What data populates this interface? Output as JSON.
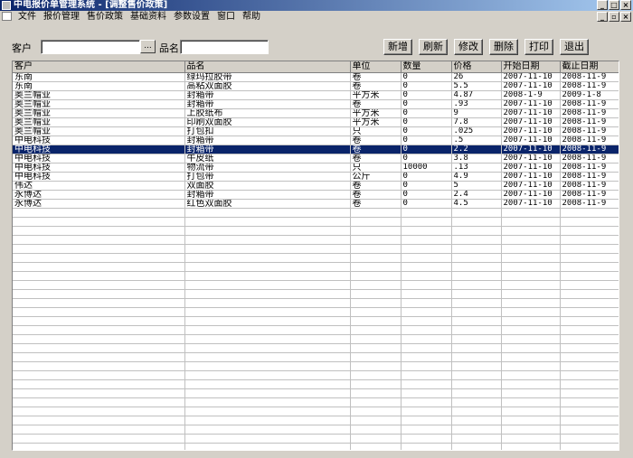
{
  "window": {
    "title": "中电报价单管理系统 - [调整售价政策]"
  },
  "menu": [
    "文件",
    "报价管理",
    "售价政策",
    "基础资料",
    "参数设置",
    "窗口",
    "帮助"
  ],
  "filters": {
    "customer_label": "客户",
    "customer_value": "",
    "ellipsis": "...",
    "product_label": "品名",
    "product_value": ""
  },
  "buttons": {
    "add": "新增",
    "refresh": "刷新",
    "edit": "修改",
    "delete": "删除",
    "print": "打印",
    "exit": "退出"
  },
  "table": {
    "columns": [
      "客户",
      "品名",
      "单位",
      "数量",
      "价格",
      "开始日期",
      "截止日期"
    ],
    "selected_index": 8,
    "rows": [
      [
        "东南",
        "绿玛拉胶带",
        "卷",
        "0",
        "26",
        "2007-11-10",
        "2008-11-9"
      ],
      [
        "东南",
        "高粘双面胶",
        "卷",
        "0",
        "5.5",
        "2007-11-10",
        "2008-11-9"
      ],
      [
        "奥兰帽业",
        "封箱带",
        "平方米",
        "0",
        "4.87",
        "2008-1-9",
        "2009-1-8"
      ],
      [
        "奥兰帽业",
        "封箱带",
        "卷",
        "0",
        ".93",
        "2007-11-10",
        "2008-11-9"
      ],
      [
        "奥兰帽业",
        "上胶纸布",
        "平方米",
        "0",
        "9",
        "2007-11-10",
        "2008-11-9"
      ],
      [
        "奥兰帽业",
        "印刷双面胶",
        "平方米",
        "0",
        "7.8",
        "2007-11-10",
        "2008-11-9"
      ],
      [
        "奥兰帽业",
        "打包扣",
        "只",
        "0",
        ".025",
        "2007-11-10",
        "2008-11-9"
      ],
      [
        "中电科技",
        "封箱带",
        "卷",
        "0",
        ".5",
        "2007-11-10",
        "2008-11-9"
      ],
      [
        "中电科技",
        "封箱带",
        "卷",
        "0",
        "2.2",
        "2007-11-10",
        "2008-11-9"
      ],
      [
        "中电科技",
        "牛皮纸",
        "卷",
        "0",
        "3.8",
        "2007-11-10",
        "2008-11-9"
      ],
      [
        "中电科技",
        "物流带",
        "只",
        "10000",
        ".13",
        "2007-11-10",
        "2008-11-9"
      ],
      [
        "中电科技",
        "打包带",
        "公斤",
        "0",
        "4.9",
        "2007-11-10",
        "2008-11-9"
      ],
      [
        "伟达",
        "双面胶",
        "卷",
        "0",
        "5",
        "2007-11-10",
        "2008-11-9"
      ],
      [
        "永博达",
        "封箱带",
        "卷",
        "0",
        "2.4",
        "2007-11-10",
        "2008-11-9"
      ],
      [
        "永博达",
        "红色双面胶",
        "卷",
        "0",
        "4.5",
        "2007-11-10",
        "2008-11-9"
      ]
    ]
  }
}
